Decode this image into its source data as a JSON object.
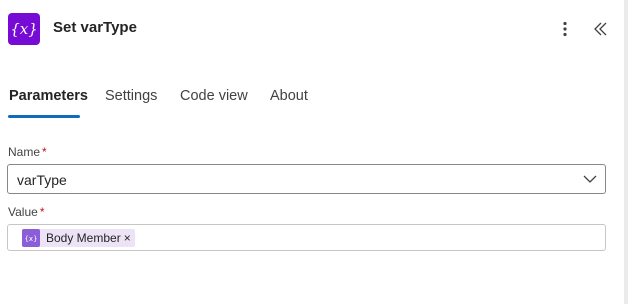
{
  "header": {
    "title": "Set varType",
    "icon": "variable-icon",
    "icon_glyph": "{x}",
    "icon_color": "#770bd6",
    "more_icon": "more-vertical-icon",
    "collapse_icon": "double-chevron-left-icon"
  },
  "tabs": [
    {
      "label": "Parameters",
      "active": true
    },
    {
      "label": "Settings",
      "active": false
    },
    {
      "label": "Code view",
      "active": false
    },
    {
      "label": "About",
      "active": false
    }
  ],
  "accent_color": "#0f6cbd",
  "fields": {
    "name": {
      "label": "Name",
      "required_marker": "*",
      "value": "varType"
    },
    "value": {
      "label": "Value",
      "required_marker": "*",
      "token": {
        "label": "Body Member",
        "icon": "expression-icon",
        "remove_glyph": "×"
      }
    }
  }
}
